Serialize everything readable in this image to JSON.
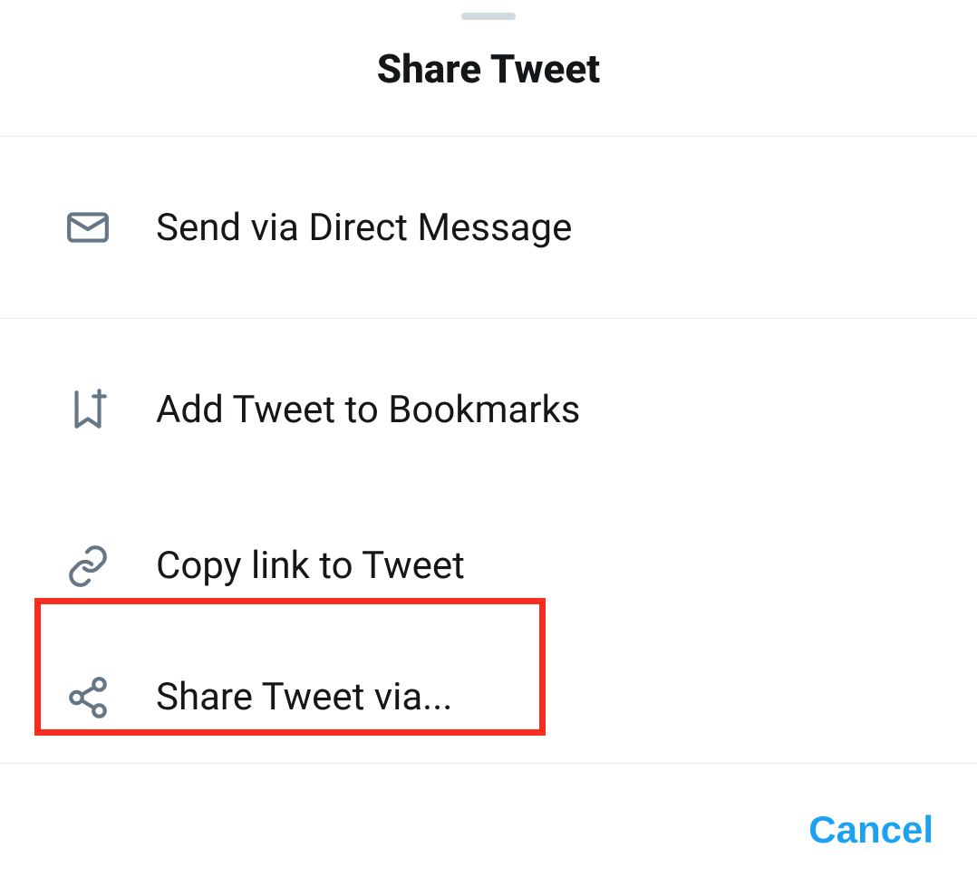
{
  "header": {
    "title": "Share Tweet"
  },
  "options": {
    "send_dm": "Send via Direct Message",
    "add_bookmark": "Add Tweet to Bookmarks",
    "copy_link": "Copy link to Tweet",
    "share_via": "Share Tweet via..."
  },
  "footer": {
    "cancel": "Cancel"
  }
}
